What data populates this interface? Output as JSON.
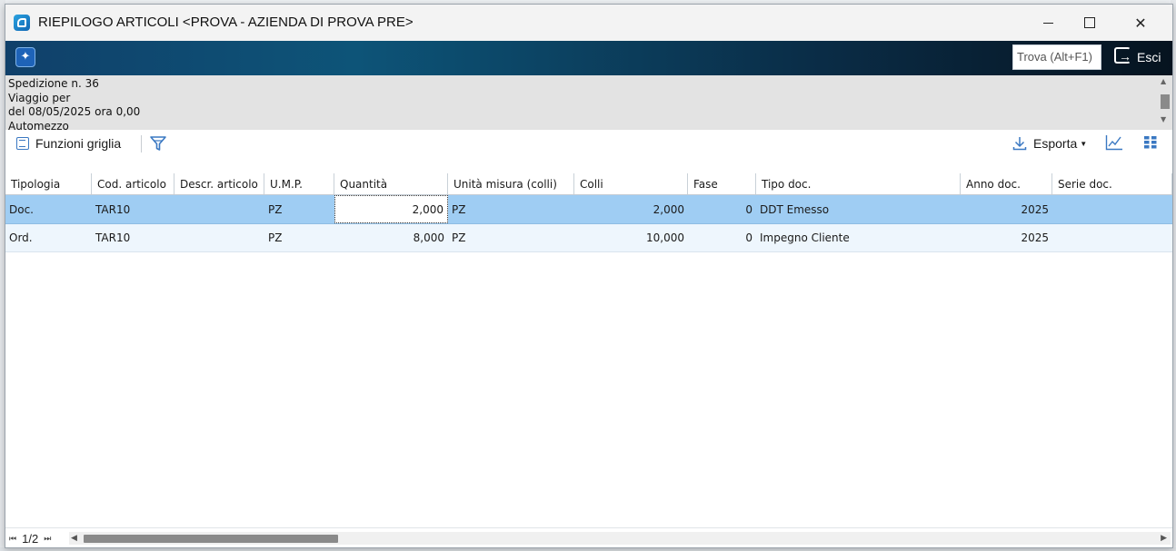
{
  "window": {
    "title": "RIEPILOGO ARTICOLI <PROVA - AZIENDA DI PROVA PRE>"
  },
  "banner": {
    "find_placeholder": "Trova (Alt+F1)",
    "exit_label": "Esci"
  },
  "info": {
    "lines": [
      "Spedizione n. 36",
      "Viaggio per",
      "del 08/05/2025 ora 0,00",
      "Automezzo"
    ]
  },
  "toolbar": {
    "grid_functions_label": "Funzioni griglia",
    "export_label": "Esporta"
  },
  "grid": {
    "columns": [
      "Tipologia",
      "Cod. articolo",
      "Descr. articolo",
      "U.M.P.",
      "Quantità",
      "Unità misura (colli)",
      "Colli",
      "Fase",
      "Tipo doc.",
      "Anno doc.",
      "Serie doc."
    ],
    "rows": [
      {
        "tipologia": "Doc.",
        "cod_articolo": "TAR10",
        "descr_articolo": "",
        "ump": "PZ",
        "quantita": "2,000",
        "unita_misura_colli": "PZ",
        "colli": "2,000",
        "fase": "0",
        "tipo_doc": "DDT Emesso",
        "anno_doc": "2025",
        "serie_doc": ""
      },
      {
        "tipologia": "Ord.",
        "cod_articolo": "TAR10",
        "descr_articolo": "",
        "ump": "PZ",
        "quantita": "8,000",
        "unita_misura_colli": "PZ",
        "colli": "10,000",
        "fase": "0",
        "tipo_doc": "Impegno Cliente",
        "anno_doc": "2025",
        "serie_doc": ""
      }
    ]
  },
  "status": {
    "page": "1/2"
  },
  "colors": {
    "selected_row": "#9fcdf3",
    "alt_row": "#eef6fd",
    "banner_start": "#10406a",
    "banner_end": "#06131f",
    "accent": "#3a78c2"
  },
  "icons": {
    "app": "app-logo-icon",
    "ai": "ai-sparkle-icon",
    "exit": "exit-icon",
    "grid_functions": "grid-list-icon",
    "filter": "filter-icon",
    "export": "download-icon",
    "chart": "chart-icon",
    "tiles": "tiles-icon"
  }
}
